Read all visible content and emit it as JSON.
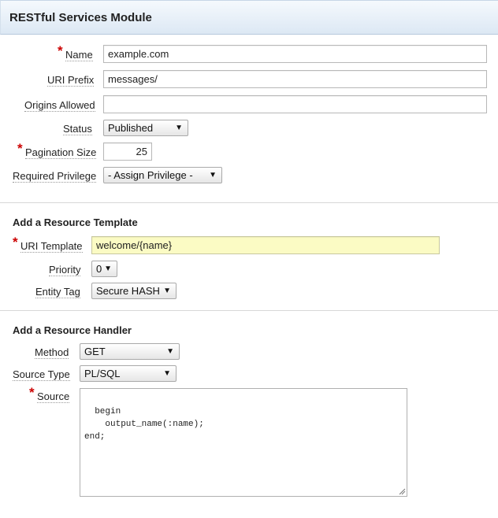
{
  "header": {
    "title": "RESTful Services Module"
  },
  "module": {
    "name_label": "Name",
    "name_value": "example.com",
    "uri_prefix_label": "URI Prefix",
    "uri_prefix_value": "messages/",
    "origins_label": "Origins Allowed",
    "origins_value": "",
    "status_label": "Status",
    "status_value": "Published",
    "pagination_label": "Pagination Size",
    "pagination_value": "25",
    "privilege_label": "Required Privilege",
    "privilege_value": "- Assign Privilege -"
  },
  "template": {
    "section_title": "Add a Resource Template",
    "uri_template_label": "URI Template",
    "uri_template_value": "welcome/{name}",
    "priority_label": "Priority",
    "priority_value": "0",
    "entity_tag_label": "Entity Tag",
    "entity_tag_value": "Secure HASH"
  },
  "handler": {
    "section_title": "Add a Resource Handler",
    "method_label": "Method",
    "method_value": "GET",
    "source_type_label": "Source Type",
    "source_type_value": "PL/SQL",
    "source_label": "Source",
    "source_value": "begin\n    output_name(:name);\nend;"
  },
  "icons": {
    "required": "*",
    "dropdown": "▼"
  },
  "colors": {
    "required": "#cc0000",
    "highlight_field": "#fbfbc4",
    "header_bg": "#dce8f4"
  }
}
